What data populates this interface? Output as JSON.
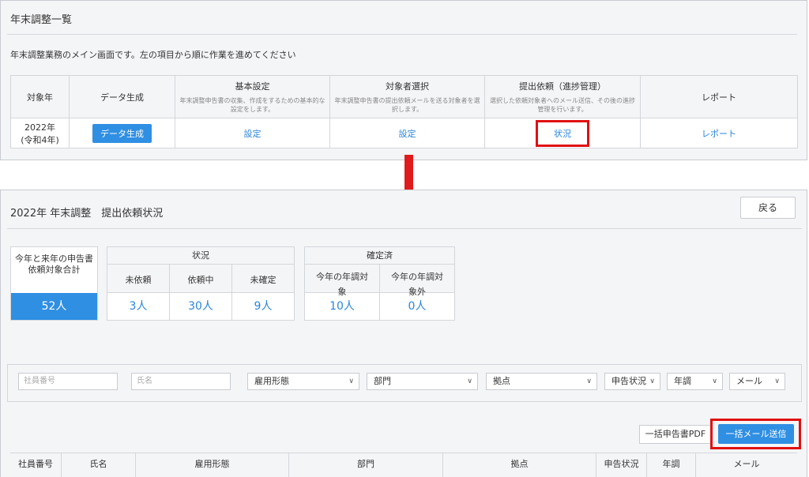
{
  "top": {
    "title": "年末調整一覧",
    "description": "年末調整業務のメイン画面です。左の項目から順に作業を進めてください",
    "table": {
      "headers": [
        {
          "label": "対象年",
          "sub": ""
        },
        {
          "label": "データ生成",
          "sub": ""
        },
        {
          "label": "基本設定",
          "sub": "年末調整申告書の収集、作成をするための基本的な設定をします。"
        },
        {
          "label": "対象者選択",
          "sub": "年末調整申告書の提出依頼メールを送る対象者を選択します。"
        },
        {
          "label": "提出依頼（進捗管理）",
          "sub": "選択した依頼対象者へのメール送信、その後の進捗管理を行います。"
        },
        {
          "label": "レポート",
          "sub": ""
        }
      ],
      "row": {
        "year": "2022年",
        "year_era": "(令和4年)",
        "generate_button": "データ生成",
        "settings_link": "設定",
        "target_link": "設定",
        "status_link": "状況",
        "report_link": "レポート"
      }
    }
  },
  "bottom": {
    "title": "2022年 年末調整　提出依頼状況",
    "back_button": "戻る",
    "summary": {
      "total_label": "今年と来年の申告書依頼対象合計",
      "total_value": "52人",
      "status_group": "状況",
      "status_items": [
        {
          "label": "未依頼",
          "value": "3人"
        },
        {
          "label": "依頼中",
          "value": "30人"
        },
        {
          "label": "未確定",
          "value": "9人"
        }
      ],
      "confirmed_group": "確定済",
      "confirmed_items": [
        {
          "label": "今年の年調対象",
          "value": "10人"
        },
        {
          "label": "今年の年調対象外",
          "value": "0人"
        }
      ]
    },
    "filters": {
      "employee_no_placeholder": "社員番号",
      "name_placeholder": "氏名",
      "employment_type": "雇用形態",
      "department": "部門",
      "location": "拠点",
      "declaration_status": "申告状況",
      "year_end": "年調",
      "mail": "メール"
    },
    "bulk_pdf_button": "一括申告書PDF",
    "bulk_mail_button": "一括メール送信",
    "columns": [
      "社員番号",
      "氏名",
      "雇用形態",
      "部門",
      "拠点",
      "申告状況",
      "年調",
      "メール"
    ]
  },
  "colors": {
    "accent": "#2f8fe3",
    "highlight": "#e01010",
    "link": "#2b86d9"
  }
}
